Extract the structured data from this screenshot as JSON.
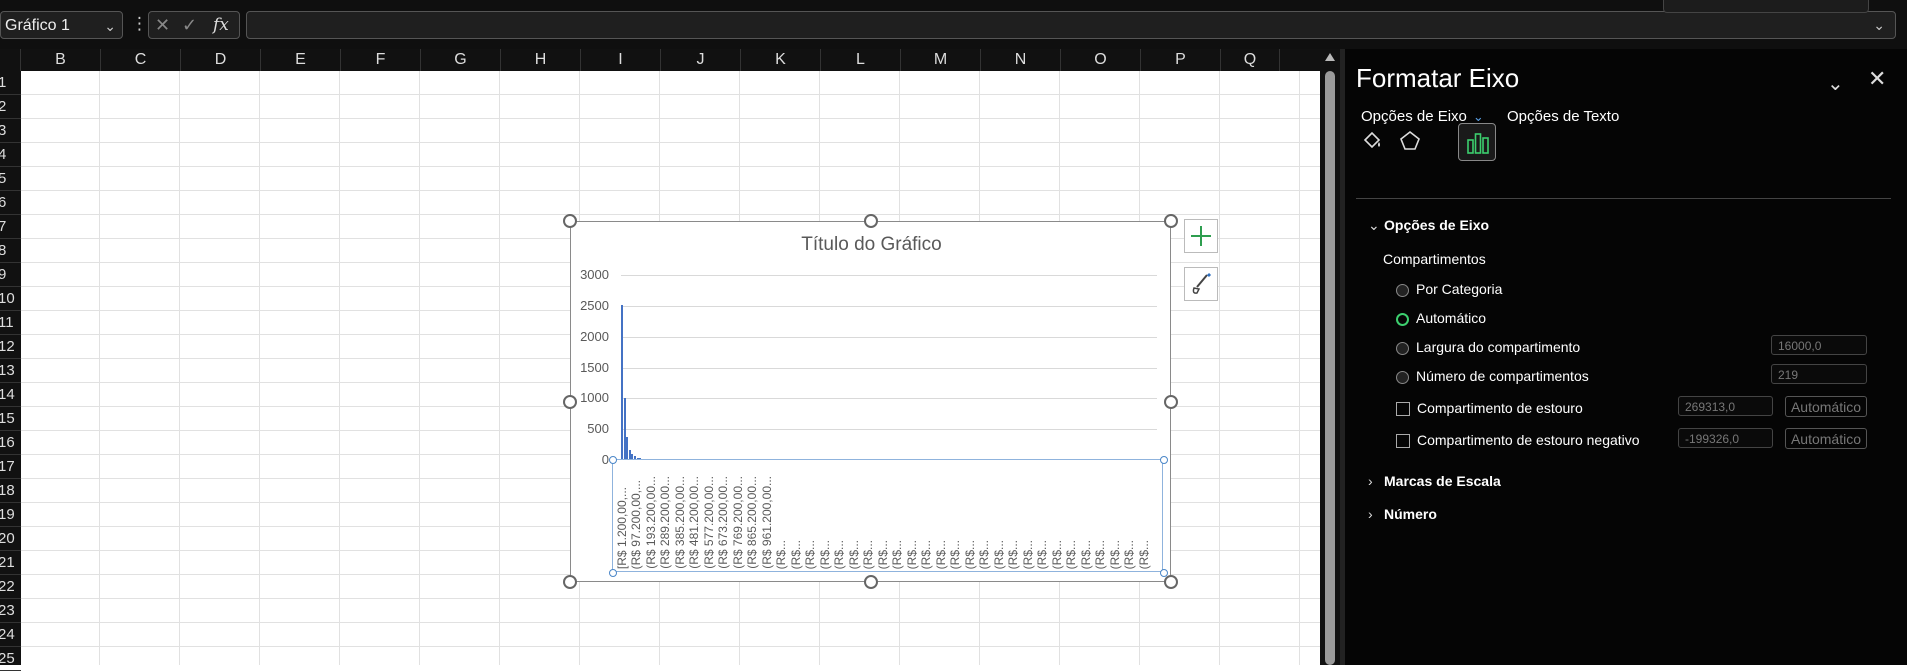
{
  "toolbar": {
    "name_box": "Gráfico 1",
    "fx_label": "fx",
    "formula_value": ""
  },
  "sheet": {
    "columns": [
      "B",
      "C",
      "D",
      "E",
      "F",
      "G",
      "H",
      "I",
      "J",
      "K",
      "L",
      "M",
      "N",
      "O",
      "P",
      "Q"
    ],
    "rows": [
      "1",
      "2",
      "3",
      "4",
      "5",
      "6",
      "7",
      "8",
      "9",
      "10",
      "11",
      "12",
      "13",
      "14",
      "15",
      "16",
      "17",
      "18",
      "19",
      "20",
      "21",
      "22",
      "23",
      "24",
      "25"
    ]
  },
  "pane": {
    "title": "Formatar Eixo",
    "tab_axis": "Opções de Eixo",
    "tab_text": "Opções de Texto",
    "icons": [
      "fill-line-icon",
      "effects-icon",
      "axis-options-icon"
    ],
    "section_axis": "Opções de Eixo",
    "bins_label": "Compartimentos",
    "opt_category": "Por Categoria",
    "opt_auto": "Automático",
    "opt_width": "Largura do compartimento",
    "opt_width_value": "16000,0",
    "opt_count": "Número de compartimentos",
    "opt_count_value": "219",
    "overflow_label": "Compartimento de estouro",
    "overflow_value": "269313,0",
    "overflow_auto": "Automático",
    "underflow_label": "Compartimento de estouro negativo",
    "underflow_value": "-199326,0",
    "underflow_auto": "Automático",
    "section_ticks": "Marcas de Escala",
    "section_number": "Número",
    "accent_color": "#3ccf6e"
  },
  "chart_data": {
    "type": "bar",
    "title": "Título do Gráfico",
    "ylim": [
      0,
      3000
    ],
    "yticks": [
      "3000",
      "2500",
      "2000",
      "1500",
      "1000",
      "500",
      "0"
    ],
    "categories": [
      "[R$ 1.200,00,...",
      "(R$ 97.200,00,...",
      "(R$ 193.200,00...",
      "(R$ 289.200,00...",
      "(R$ 385.200,00...",
      "(R$ 481.200,00...",
      "(R$ 577.200,00...",
      "(R$ 673.200,00...",
      "(R$ 769.200,00...",
      "(R$ 865.200,00...",
      "(R$ 961.200,00...",
      "(R$...",
      "(R$...",
      "(R$...",
      "(R$...",
      "(R$...",
      "(R$...",
      "(R$...",
      "(R$...",
      "(R$...",
      "(R$...",
      "(R$...",
      "(R$...",
      "(R$...",
      "(R$...",
      "(R$...",
      "(R$...",
      "(R$...",
      "(R$...",
      "(R$...",
      "(R$...",
      "(R$...",
      "(R$...",
      "(R$...",
      "(R$...",
      "(R$...",
      "(R$..."
    ],
    "values": [
      2520,
      1000,
      380,
      170,
      90,
      60,
      40,
      30,
      20,
      15,
      10
    ],
    "bar_color": "#4472c4"
  }
}
